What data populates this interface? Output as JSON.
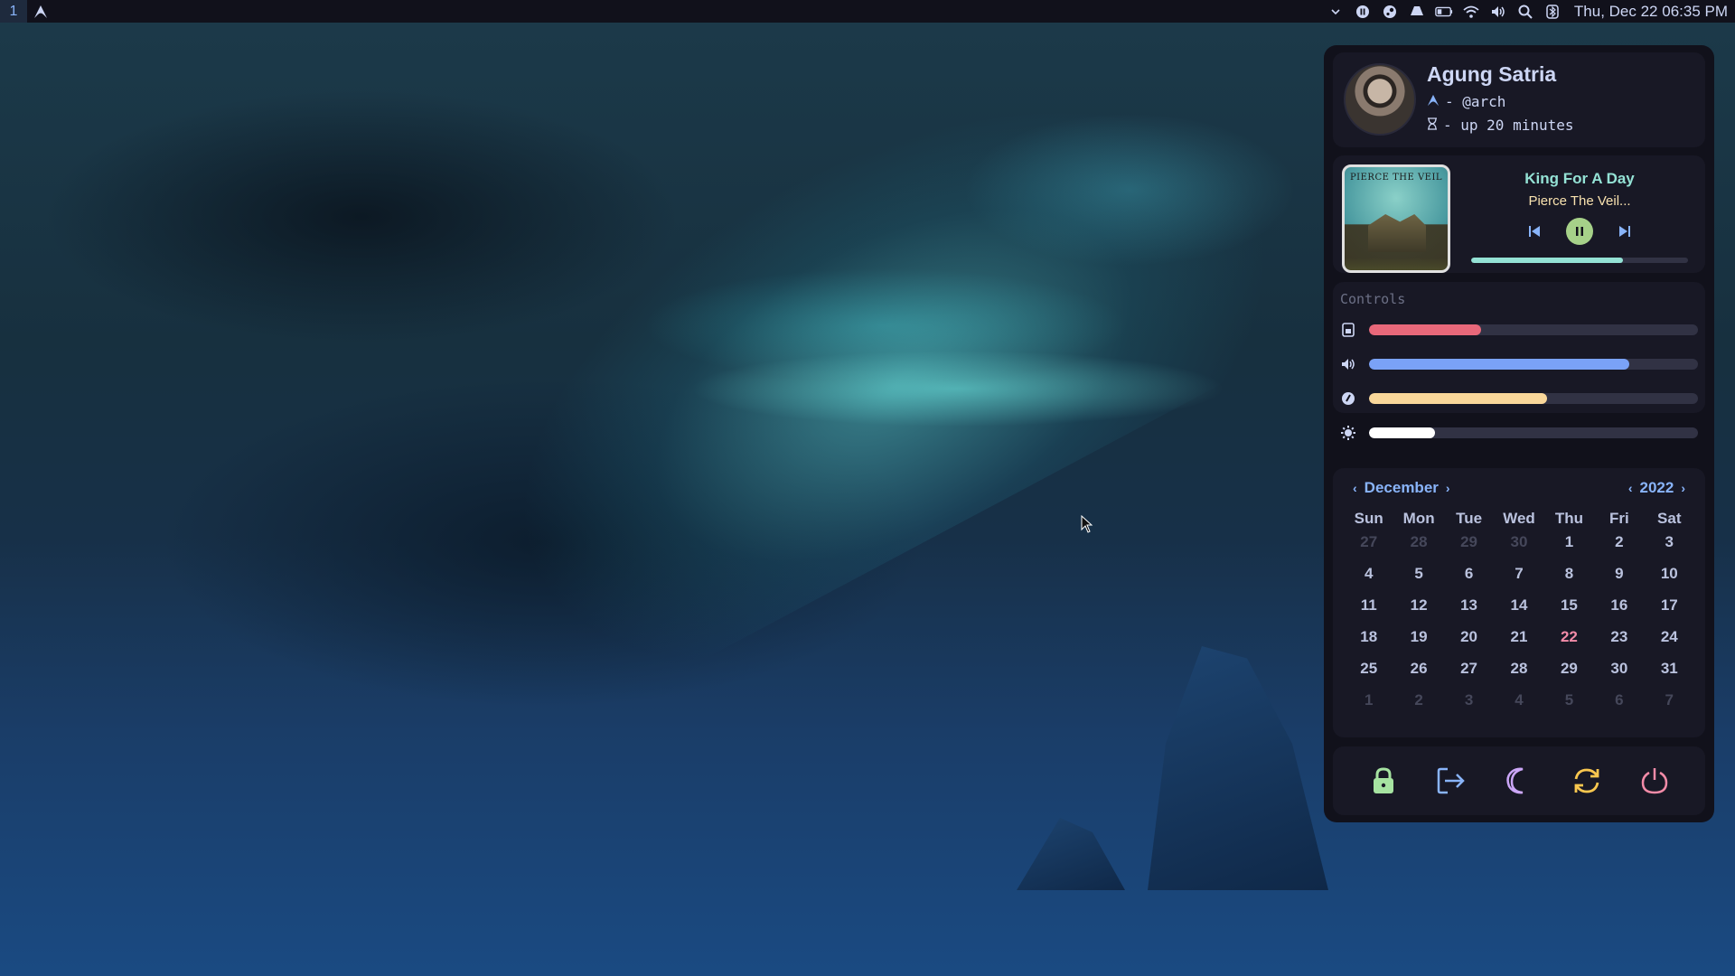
{
  "topbar": {
    "workspace": "1",
    "clock": "Thu, Dec 22  06:35 PM",
    "tray_icons": [
      "chevron-down-icon",
      "media-pause-icon",
      "steam-icon",
      "drive-icon",
      "battery-icon",
      "wifi-icon",
      "volume-icon",
      "search-icon",
      "bluetooth-icon"
    ]
  },
  "profile": {
    "name": "Agung Satria",
    "host": "- @arch",
    "uptime": "- up 20 minutes"
  },
  "music": {
    "album_text": "PIERCE THE VEIL",
    "title": "King For A Day",
    "artist": "Pierce The Veil...",
    "progress": 0.7
  },
  "controls": {
    "title": "Controls",
    "sliders": [
      {
        "name": "memory",
        "icon": "memory-icon",
        "value": 0.34,
        "color": "#e8687a"
      },
      {
        "name": "volume",
        "icon": "volume-icon",
        "value": 0.79,
        "color": "#7aa2f7"
      },
      {
        "name": "microphone",
        "icon": "mic-icon",
        "value": 0.54,
        "color": "#f9d79a"
      },
      {
        "name": "brightness",
        "icon": "brightness-icon",
        "value": 0.2,
        "color": "#ffffff"
      }
    ]
  },
  "calendar": {
    "month": "December",
    "year": "2022",
    "weekdays": [
      "Sun",
      "Mon",
      "Tue",
      "Wed",
      "Thu",
      "Fri",
      "Sat"
    ],
    "days": [
      {
        "d": "27",
        "dim": true
      },
      {
        "d": "28",
        "dim": true
      },
      {
        "d": "29",
        "dim": true
      },
      {
        "d": "30",
        "dim": true
      },
      {
        "d": "1"
      },
      {
        "d": "2"
      },
      {
        "d": "3"
      },
      {
        "d": "4"
      },
      {
        "d": "5"
      },
      {
        "d": "6"
      },
      {
        "d": "7"
      },
      {
        "d": "8"
      },
      {
        "d": "9"
      },
      {
        "d": "10"
      },
      {
        "d": "11"
      },
      {
        "d": "12"
      },
      {
        "d": "13"
      },
      {
        "d": "14"
      },
      {
        "d": "15"
      },
      {
        "d": "16"
      },
      {
        "d": "17"
      },
      {
        "d": "18"
      },
      {
        "d": "19"
      },
      {
        "d": "20"
      },
      {
        "d": "21"
      },
      {
        "d": "22",
        "today": true
      },
      {
        "d": "23"
      },
      {
        "d": "24"
      },
      {
        "d": "25"
      },
      {
        "d": "26"
      },
      {
        "d": "27"
      },
      {
        "d": "28"
      },
      {
        "d": "29"
      },
      {
        "d": "30"
      },
      {
        "d": "31"
      },
      {
        "d": "1",
        "dim": true
      },
      {
        "d": "2",
        "dim": true
      },
      {
        "d": "3",
        "dim": true
      },
      {
        "d": "4",
        "dim": true
      },
      {
        "d": "5",
        "dim": true
      },
      {
        "d": "6",
        "dim": true
      },
      {
        "d": "7",
        "dim": true
      }
    ]
  },
  "power": [
    {
      "name": "lock",
      "icon": "lock-icon",
      "color": "#a6e3a1"
    },
    {
      "name": "logout",
      "icon": "logout-icon",
      "color": "#89b4fa"
    },
    {
      "name": "sleep",
      "icon": "moon-icon",
      "color": "#cba6f7"
    },
    {
      "name": "reboot",
      "icon": "refresh-icon",
      "color": "#f9c74f"
    },
    {
      "name": "shutdown",
      "icon": "power-icon",
      "color": "#f38ba8"
    }
  ]
}
